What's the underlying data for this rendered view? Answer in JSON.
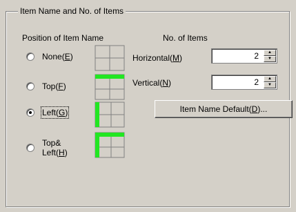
{
  "group_title": "Item Name and No. of Items",
  "position_header": "Position of Item Name",
  "count_header": "No. of Items",
  "radios": [
    {
      "text": "None",
      "key": "E",
      "checked": false
    },
    {
      "text": "Top",
      "key": "F",
      "checked": false
    },
    {
      "text": "Left",
      "key": "G",
      "checked": true
    },
    {
      "text_line1": "Top&",
      "text_line2": "Left",
      "key": "H",
      "checked": false
    }
  ],
  "horizontal": {
    "label": "Horizontal",
    "key": "M",
    "value": "2"
  },
  "vertical": {
    "label": "Vertical",
    "key": "N",
    "value": "2"
  },
  "default_button": {
    "label": "Item Name Default",
    "key": "D",
    "suffix": "..."
  },
  "colors": {
    "highlight": "#22e622",
    "grid": "#808080"
  }
}
